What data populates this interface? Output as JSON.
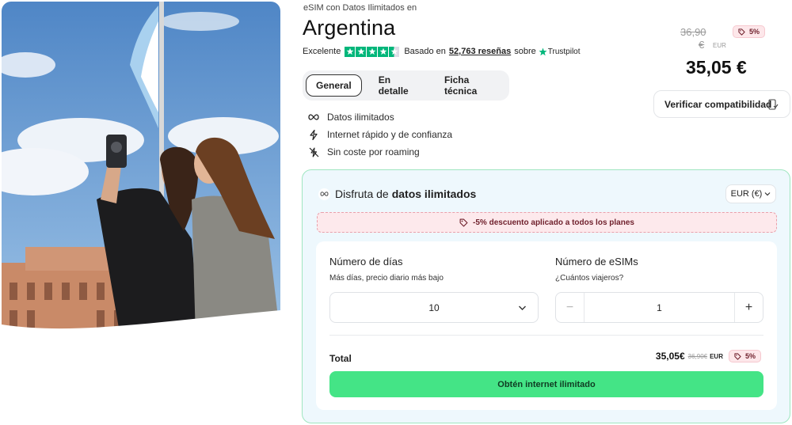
{
  "product": {
    "subtitle": "eSIM con Datos Ilimitados en",
    "country": "Argentina"
  },
  "rating": {
    "label": "Excelente",
    "stars": 4.5,
    "based_on": "Basado en",
    "reviews": "52,763 reseñas",
    "on": "sobre",
    "provider": "Trustpilot"
  },
  "tabs": [
    {
      "label": "General",
      "active": true
    },
    {
      "label": "En detalle",
      "active": false
    },
    {
      "label": "Ficha técnica",
      "active": false
    }
  ],
  "features": [
    {
      "icon": "infinity-icon",
      "label": "Datos ilimitados"
    },
    {
      "icon": "lightning-icon",
      "label": "Internet rápido y de confianza"
    },
    {
      "icon": "no-roaming-icon",
      "label": "Sin coste por roaming"
    }
  ],
  "pricing": {
    "old_price_line1": "36,90",
    "old_price_line2": "€",
    "old_currency": "EUR",
    "discount_badge": "5%",
    "price": "35,05 €",
    "verify_label": "Verificar compatibilidad"
  },
  "plans": {
    "title_prefix": "Disfruta de",
    "title_bold": "datos ilimitados",
    "currency_select": "EUR (€)",
    "discount_notice": "-5% descuento aplicado a todos los planes",
    "days_label": "Número de días",
    "days_sub": "Más días, precio diario más bajo",
    "days_value": "10",
    "esims_label": "Número de eSIMs",
    "esims_sub": "¿Cuántos viajeros?",
    "esims_value": "1",
    "minus": "−",
    "plus": "+",
    "total_label": "Total",
    "total_price": "35,05€",
    "total_old": "36,90€",
    "total_currency": "EUR",
    "total_badge": "5%",
    "cta": "Obtén internet ilimitado"
  },
  "colors": {
    "trustpilot_green": "#00b67a",
    "cta_green": "#44e486",
    "panel_border": "#9fe6c0",
    "badge_bg": "#fde7ea"
  }
}
